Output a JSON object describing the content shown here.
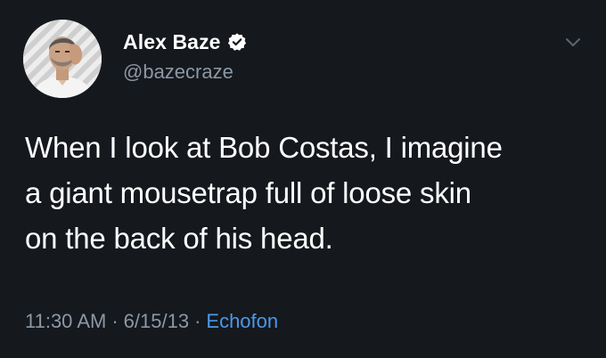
{
  "user": {
    "display_name": "Alex Baze",
    "handle": "@bazecraze",
    "verified": true,
    "avatar_icon": "user-avatar-photo"
  },
  "tweet": {
    "lines": [
      "When I look at Bob Costas, I imagine",
      "a giant mousetrap full of loose skin",
      "on the back of his head."
    ]
  },
  "meta": {
    "time": "11:30 AM",
    "separator": "·",
    "date": "6/15/13",
    "source": "Echofon"
  },
  "icons": {
    "verified": "verified-badge-icon",
    "menu": "chevron-down-icon"
  },
  "colors": {
    "background": "#15181d",
    "secondary_text": "#8b98a5",
    "link": "#4a99e9"
  }
}
